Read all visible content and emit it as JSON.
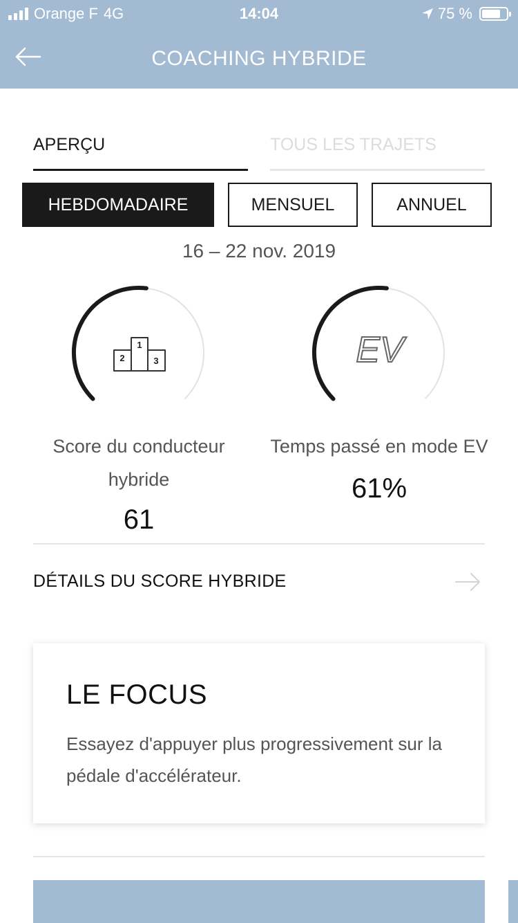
{
  "status_bar": {
    "carrier": "Orange F",
    "network": "4G",
    "time": "14:04",
    "battery": "75 %",
    "battery_level": 0.75
  },
  "header": {
    "title": "COACHING HYBRIDE",
    "back_icon": "arrow-left-icon"
  },
  "tabs": [
    {
      "label": "APERÇU",
      "active": true
    },
    {
      "label": "TOUS LES TRAJETS",
      "active": false
    }
  ],
  "periods": [
    {
      "label": "HEBDOMADAIRE",
      "active": true
    },
    {
      "label": "MENSUEL",
      "active": false
    },
    {
      "label": "ANNUEL",
      "active": false
    }
  ],
  "date_range": "16 – 22 nov. 2019",
  "gauges": [
    {
      "icon": "podium-icon",
      "icon_labels": [
        "1",
        "2",
        "3"
      ],
      "label": "Score du conducteur hybride",
      "value": "61",
      "level": 0.61
    },
    {
      "icon": "ev-icon",
      "icon_text": "EV",
      "label": "Temps passé en mode EV",
      "value": "61%",
      "level": 0.61
    }
  ],
  "details": {
    "label": "DÉTAILS DU SCORE HYBRIDE",
    "icon": "arrow-right-icon"
  },
  "focus_card": {
    "title": "LE FOCUS",
    "text": "Essayez d'appuyer plus progressivement sur la pédale d'accélérateur."
  },
  "colors": {
    "header": "#a3bad3",
    "dark": "#1a1a1a",
    "muted": "#555555"
  }
}
